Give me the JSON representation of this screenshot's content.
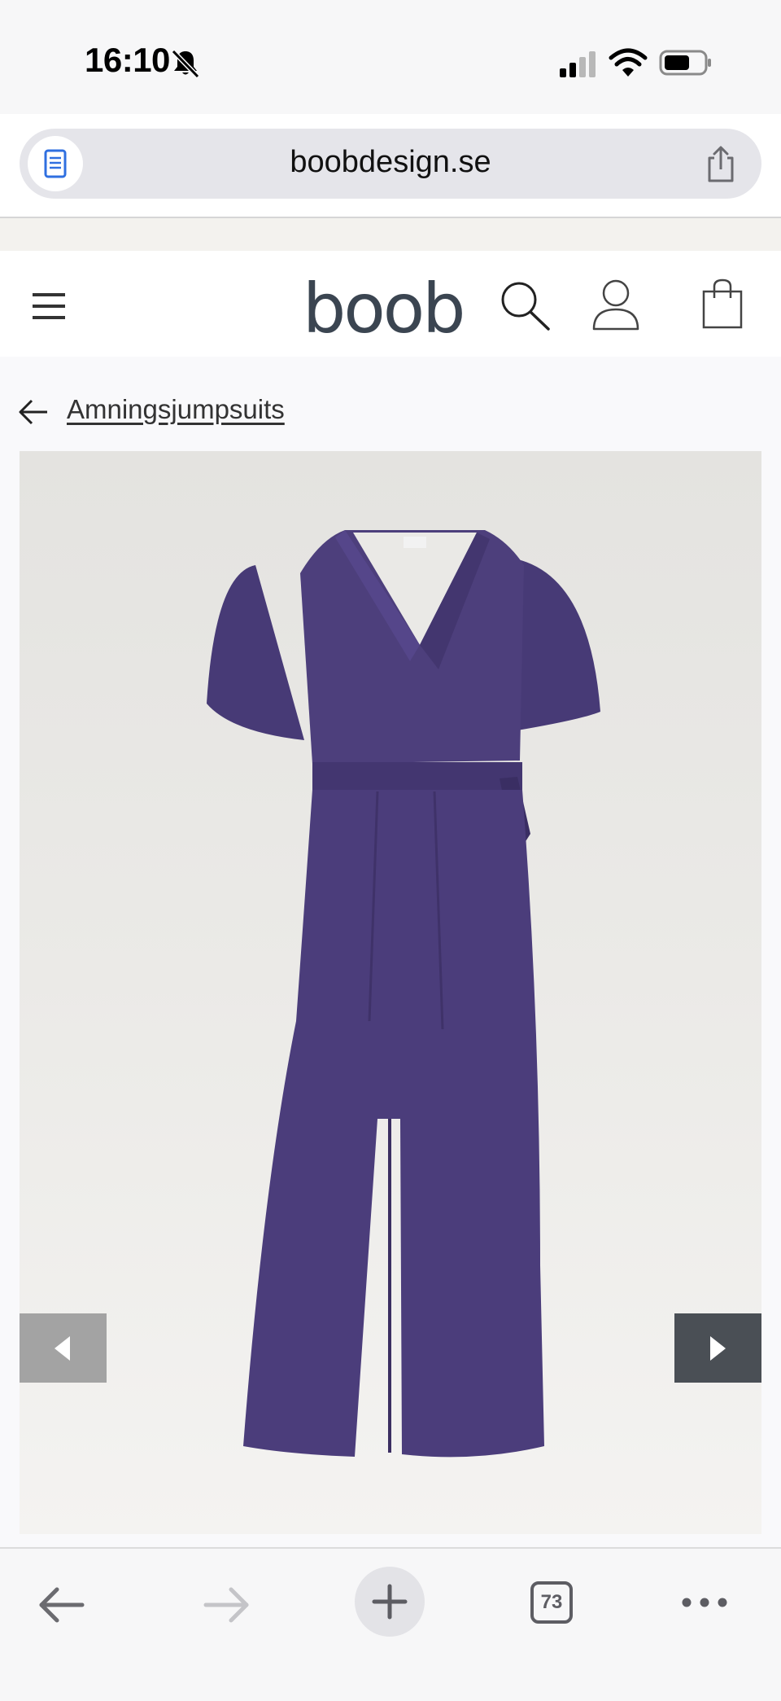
{
  "status_bar": {
    "time": "16:10",
    "icons": [
      "bell-slash-icon",
      "cellular-signal-icon",
      "wifi-icon",
      "battery-icon"
    ]
  },
  "browser": {
    "url": "boobdesign.se",
    "reader_icon": "reader-mode-icon",
    "share_icon": "share-icon",
    "tab_count": "73",
    "toolbar_icons": [
      "back-arrow-icon",
      "forward-arrow-icon",
      "plus-icon",
      "tabs-icon",
      "more-icon"
    ]
  },
  "site_header": {
    "logo": "boob",
    "icons": [
      "menu-icon",
      "search-icon",
      "account-icon",
      "shopping-bag-icon"
    ]
  },
  "breadcrumb": {
    "label": "Amningsjumpsuits"
  },
  "product_image": {
    "alt_subject": "purple wrap jumpsuit",
    "garment_color": "#4d3f7c",
    "carousel": {
      "prev_icon": "triangle-left-icon",
      "next_icon": "triangle-right-icon"
    }
  },
  "colors": {
    "logo": "#3b4551",
    "carousel_prev_bg": "#a3a3a3",
    "carousel_next_bg": "#4a4f55"
  }
}
